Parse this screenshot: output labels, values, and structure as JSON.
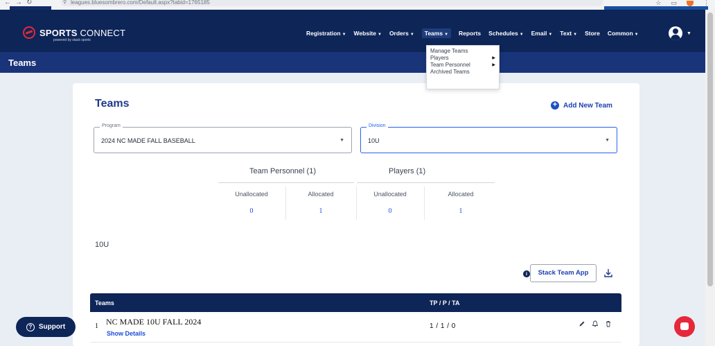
{
  "browser": {
    "url": "leagues.bluesombrero.com/Default.aspx?tabid=1765185"
  },
  "header": {
    "brand_bold": "SPORTS",
    "brand_light": " CONNECT",
    "powered": "powered by stack sports",
    "menu": [
      {
        "label": "Registration",
        "caret": "▼"
      },
      {
        "label": "Website",
        "caret": "▼"
      },
      {
        "label": "Orders",
        "caret": "▼"
      },
      {
        "label": "Teams",
        "caret": "▼"
      },
      {
        "label": "Reports",
        "caret": ""
      },
      {
        "label": "Schedules",
        "caret": "▼"
      },
      {
        "label": "Email",
        "caret": "▼"
      },
      {
        "label": "Text",
        "caret": "▼"
      },
      {
        "label": "Store",
        "caret": ""
      },
      {
        "label": "Common",
        "caret": "▼"
      }
    ]
  },
  "subbar": {
    "title": "Teams"
  },
  "teams_dropdown": {
    "items": [
      {
        "label": "Manage Teams",
        "has_sub": false
      },
      {
        "label": "Players",
        "has_sub": true
      },
      {
        "label": "Team Personnel",
        "has_sub": true
      },
      {
        "label": "Archived Teams",
        "has_sub": false
      }
    ]
  },
  "card": {
    "title": "Teams",
    "add_team": "Add New Team",
    "program": {
      "label": "Program",
      "value": "2024 NC MADE FALL BASEBALL"
    },
    "division": {
      "label": "Division",
      "value": "10U"
    },
    "stats": {
      "team_personnel": "Team Personnel (1)",
      "players": "Players (1)",
      "cols": [
        {
          "label": "Unallocated",
          "value": "0"
        },
        {
          "label": "Allocated",
          "value": "1"
        },
        {
          "label": "Unallocated",
          "value": "0"
        },
        {
          "label": "Allocated",
          "value": "1"
        }
      ]
    },
    "division_heading": "10U",
    "stack_team_app": "Stack Team App",
    "table": {
      "headers": [
        "Teams",
        "TP / P / TA"
      ],
      "rows": [
        {
          "num": "1",
          "name": "NC MADE 10U FALL 2024",
          "details": "Show Details",
          "tp_p_ta": "1 / 1 / 0"
        }
      ]
    }
  },
  "support": {
    "label": "Support"
  },
  "colors": {
    "navy": "#0e2558",
    "accent_blue": "#1d4ed8",
    "brand_red": "#e5283a"
  }
}
